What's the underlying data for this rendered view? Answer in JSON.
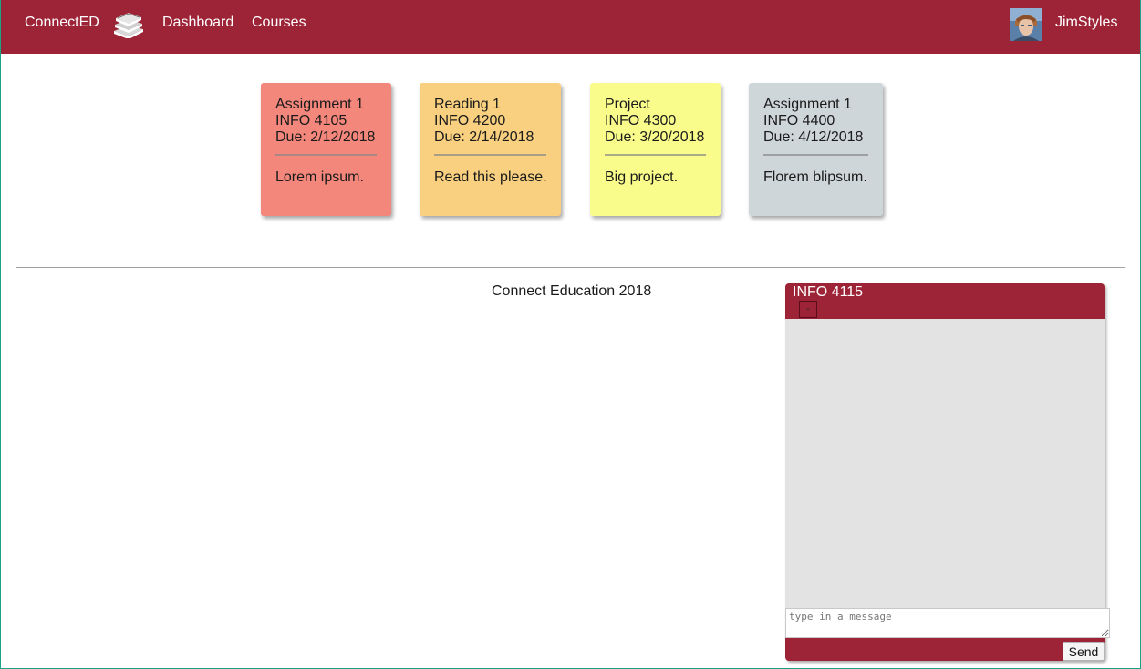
{
  "nav": {
    "brand": "ConnectED",
    "dashboard": "Dashboard",
    "courses": "Courses",
    "username": "JimStyles"
  },
  "cards": [
    {
      "title": "Assignment 1",
      "course": "INFO 4105",
      "due": "Due: 2/12/2018",
      "note": "Lorem ipsum.",
      "color": "#f4877c"
    },
    {
      "title": "Reading 1",
      "course": "INFO 4200",
      "due": "Due: 2/14/2018",
      "note": "Read this please.",
      "color": "#f8d07f"
    },
    {
      "title": "Project",
      "course": "INFO 4300",
      "due": "Due: 3/20/2018",
      "note": "Big project.",
      "color": "#f9fc8b"
    },
    {
      "title": "Assignment 1",
      "course": "INFO 4400",
      "due": "Due: 4/12/2018",
      "note": "Florem blipsum.",
      "color": "#cfd6da"
    }
  ],
  "footer": "Connect Education 2018",
  "chat": {
    "title": "INFO 4115",
    "minimize_label": "-",
    "input_placeholder": "type in a message",
    "send_label": "Send"
  },
  "colors": {
    "brand": "#9c2436",
    "chat_body": "#e3e3e3"
  }
}
